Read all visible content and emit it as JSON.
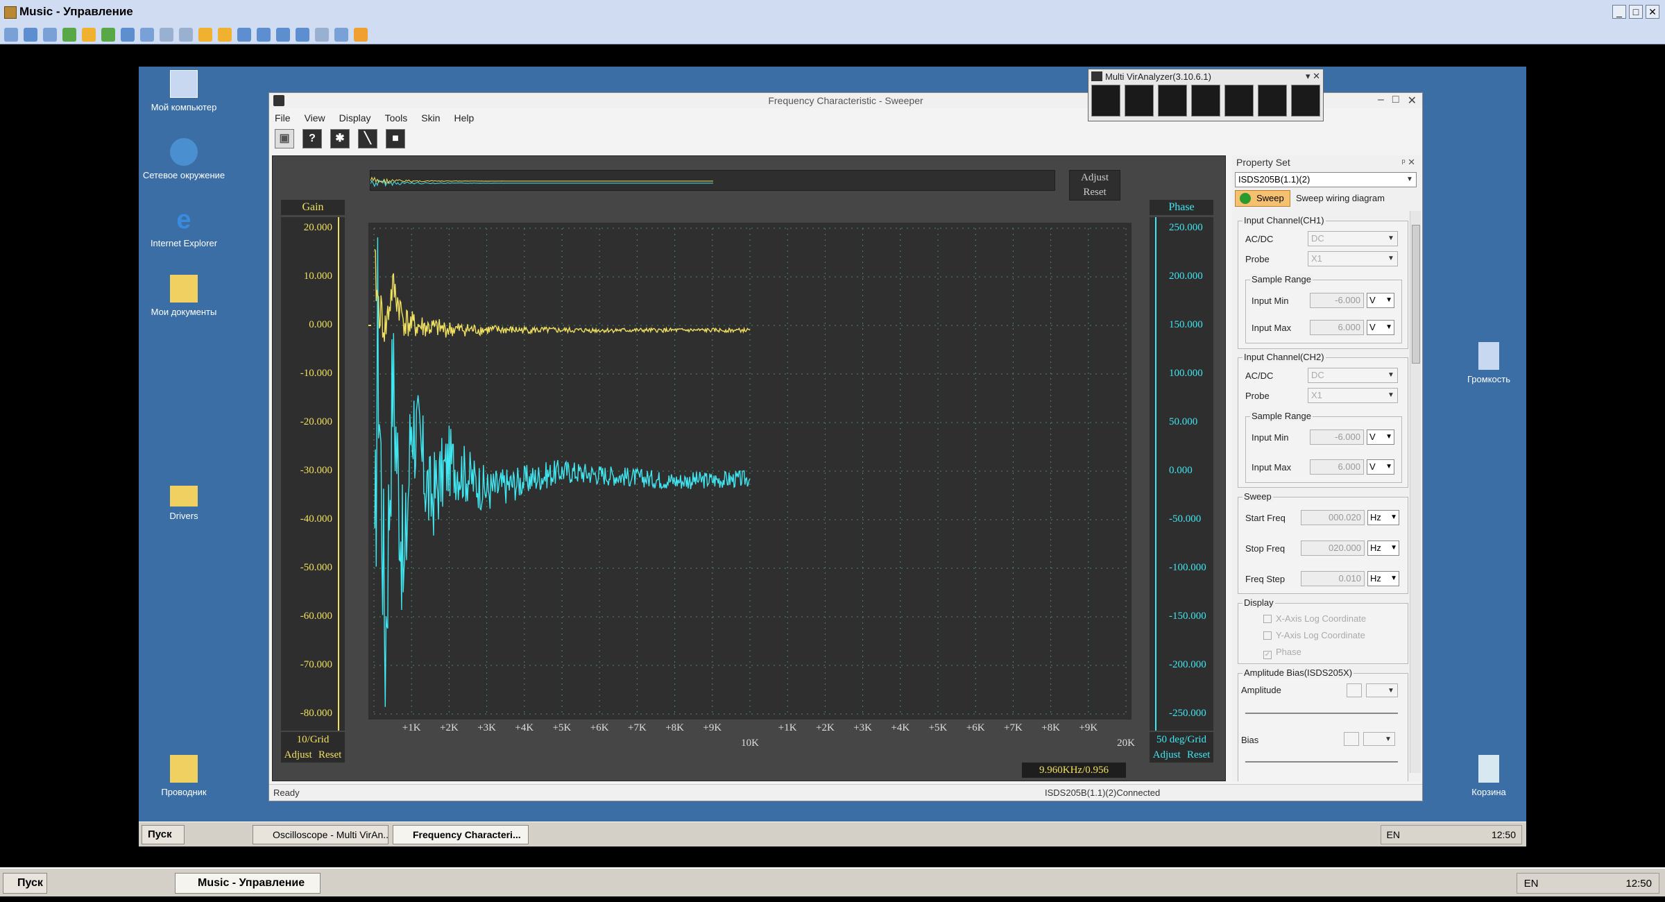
{
  "host": {
    "window_title": "Music - Управление",
    "window_buttons": [
      "_",
      "□",
      "✕"
    ],
    "start_label": "Пуск",
    "task_label": "Music - Управление",
    "lang": "EN",
    "clock": "12:50"
  },
  "desktop": {
    "icons": [
      {
        "label": "Мой компьютер"
      },
      {
        "label": "Сетевое окружение"
      },
      {
        "label": "Internet Explorer"
      },
      {
        "label": "Мои документы"
      },
      {
        "label": "Drivers"
      },
      {
        "label": "Проводник"
      },
      {
        "label": "Громкость"
      },
      {
        "label": "Корзина"
      }
    ],
    "taskbar": {
      "start_label": "Пуск",
      "tasks": [
        {
          "label": "Oscilloscope - Multi VirAn..."
        },
        {
          "label": "Frequency Characteri..."
        }
      ],
      "lang": "EN",
      "clock": "12:50"
    }
  },
  "app": {
    "title": "Frequency Characteristic - Sweeper",
    "menu": [
      "File",
      "View",
      "Display",
      "Tools",
      "Skin",
      "Help"
    ],
    "mini_adjust": "Adjust",
    "mini_reset": "Reset",
    "status_left": "Ready",
    "status_right": "ISDS205B(1.1)(2)Connected"
  },
  "mva": {
    "title": "Multi VirAnalyzer(3.10.6.1)"
  },
  "chart_data": {
    "type": "line",
    "left_axis_label": "Gain",
    "right_axis_label": "Phase",
    "gain_ticks": [
      "20.000",
      "10.000",
      "0.000",
      "-10.000",
      "-20.000",
      "-30.000",
      "-40.000",
      "-50.000",
      "-60.000",
      "-70.000",
      "-80.000"
    ],
    "phase_ticks": [
      "250.000",
      "200.000",
      "150.000",
      "100.000",
      "50.000",
      "0.000",
      "-50.000",
      "-100.000",
      "-150.000",
      "-200.000",
      "-250.000"
    ],
    "gain_ylim": [
      -80,
      20
    ],
    "phase_ylim": [
      -250,
      250
    ],
    "x_ticks": [
      "+1K",
      "+2K",
      "+3K",
      "+4K",
      "+5K",
      "+6K",
      "+7K",
      "+8K",
      "+9K",
      "+1K",
      "+2K",
      "+3K",
      "+4K",
      "+5K",
      "+6K",
      "+7K",
      "+8K",
      "+9K"
    ],
    "x_major": [
      "10K",
      "20K"
    ],
    "xlim": [
      0,
      20000
    ],
    "gain_grid": "10/Grid",
    "phase_grid": "50 deg/Grid",
    "adjust_label": "Adjust",
    "reset_label": "Reset",
    "readout": "9.960KHz/0.956",
    "grid": true,
    "series": [
      {
        "name": "Gain",
        "color": "#f0e060",
        "x": [
          20,
          100,
          300,
          500,
          800,
          1000,
          1500,
          2000,
          3000,
          5000,
          8000,
          10000
        ],
        "y": [
          12,
          5,
          -1,
          8,
          1,
          0,
          -0.5,
          -0.8,
          -0.9,
          -1,
          -1,
          -1
        ]
      },
      {
        "name": "Phase",
        "color": "#40e6f0",
        "x": [
          20,
          100,
          300,
          500,
          800,
          1000,
          1500,
          2000,
          3000,
          5000,
          8000,
          10000
        ],
        "y": [
          -150,
          150,
          -180,
          100,
          -120,
          60,
          -30,
          10,
          -20,
          0,
          -10,
          -8
        ]
      }
    ]
  },
  "property": {
    "header": "Property Set",
    "header_btns": "ᵖ ✕",
    "device": "ISDS205B(1.1)(2)",
    "sweep_tab": "Sweep",
    "sweep_link": "Sweep wiring diagram",
    "ch1": {
      "title": "Input Channel(CH1)",
      "acdc_label": "AC/DC",
      "acdc": "DC",
      "probe_label": "Probe",
      "probe": "X1",
      "range_title": "Sample Range",
      "min_label": "Input Min",
      "min": "-6.000",
      "min_unit": "V",
      "max_label": "Input Max",
      "max": "6.000",
      "max_unit": "V"
    },
    "ch2": {
      "title": "Input Channel(CH2)",
      "acdc_label": "AC/DC",
      "acdc": "DC",
      "probe_label": "Probe",
      "probe": "X1",
      "range_title": "Sample Range",
      "min_label": "Input Min",
      "min": "-6.000",
      "min_unit": "V",
      "max_label": "Input Max",
      "max": "6.000",
      "max_unit": "V"
    },
    "sweep": {
      "title": "Sweep",
      "start_label": "Start Freq",
      "start": "000.020",
      "start_unit": "Hz",
      "stop_label": "Stop Freq",
      "stop": "020.000",
      "stop_unit": "Hz",
      "step_label": "Freq Step",
      "step": "0.010",
      "step_unit": "Hz"
    },
    "display": {
      "title": "Display",
      "xlog": "X-Axis Log Coordinate",
      "ylog": "Y-Axis Log Coordinate",
      "phase": "Phase",
      "phase_checked": true
    },
    "bias": {
      "title": "Amplitude Bias(ISDS205X)",
      "amplitude_label": "Amplitude",
      "bias_label": "Bias"
    }
  }
}
